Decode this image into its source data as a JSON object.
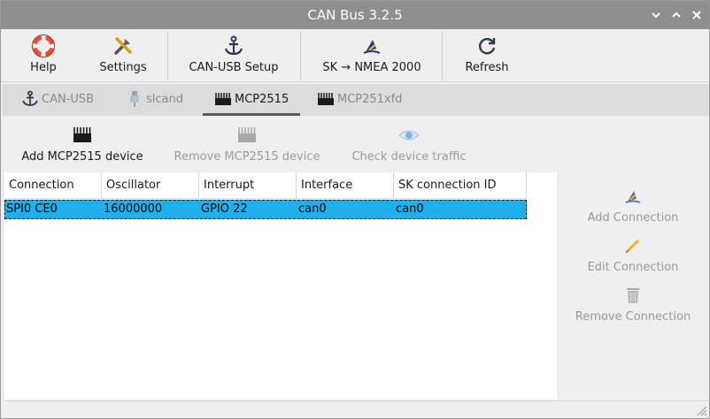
{
  "window": {
    "title": "CAN Bus 3.2.5",
    "controls": [
      "minimize",
      "maximize",
      "close"
    ]
  },
  "toolbar": {
    "items": [
      {
        "label": "Help",
        "icon": "lifebuoy-icon"
      },
      {
        "label": "Settings",
        "icon": "tools-icon"
      },
      {
        "label": "CAN-USB Setup",
        "icon": "anchor-icon"
      },
      {
        "label": "SK → NMEA 2000",
        "icon": "signalk-icon"
      },
      {
        "label": "Refresh",
        "icon": "refresh-icon"
      }
    ]
  },
  "tabs": [
    {
      "label": "CAN-USB",
      "icon": "anchor-icon",
      "active": false
    },
    {
      "label": "slcand",
      "icon": "usb-plug-icon",
      "active": false
    },
    {
      "label": "MCP2515",
      "icon": "chip-icon",
      "active": true
    },
    {
      "label": "MCP251xfd",
      "icon": "chip-icon",
      "active": false
    }
  ],
  "actions": {
    "add": "Add MCP2515 device",
    "remove": "Remove MCP2515 device",
    "check": "Check device traffic"
  },
  "table": {
    "columns": [
      "Connection",
      "Oscillator",
      "Interrupt",
      "Interface",
      "SK connection ID"
    ],
    "rows": [
      {
        "connection": "SPI0 CE0",
        "oscillator": "16000000",
        "interrupt": "GPIO 22",
        "interface": "can0",
        "sk_id": "can0",
        "selected": true
      }
    ]
  },
  "sidebar": {
    "add": "Add Connection",
    "edit": "Edit Connection",
    "remove": "Remove Connection"
  },
  "colors": {
    "titlebar": "#8e8e8e",
    "selection": "#1fb0ec",
    "help_icon": "#e94b3c",
    "signalk_blue": "#1f3a8a",
    "signalk_yellow": "#f2c500"
  }
}
